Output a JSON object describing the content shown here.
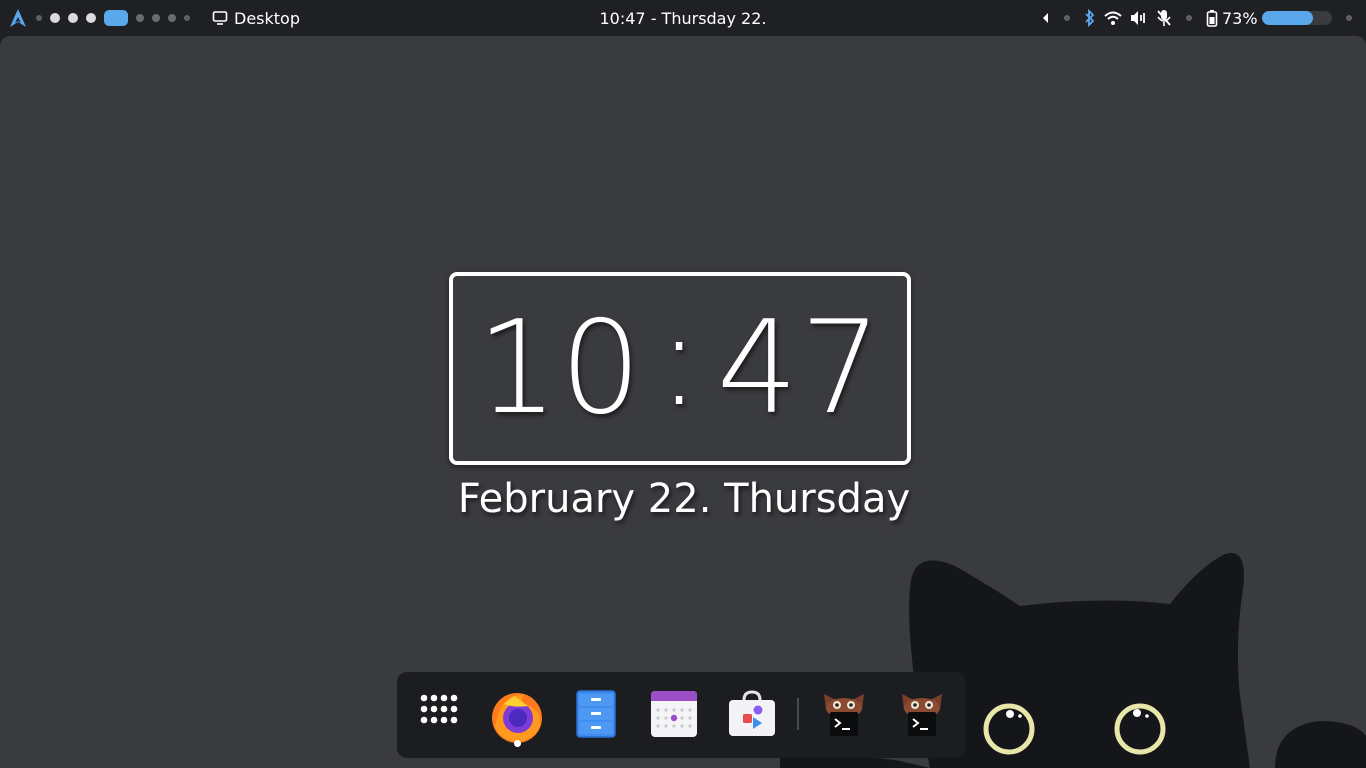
{
  "topbar": {
    "activities_icon": "arch-logo-icon",
    "window_title": "Desktop",
    "clock": "10:47 - Thursday 22.",
    "battery_percent": "73%",
    "battery_level": 0.73,
    "workspaces_total": 8,
    "workspace_active_index": 3
  },
  "clock_widget": {
    "hours": "10",
    "minutes": "47",
    "separator": ":",
    "date": "February 22. Thursday"
  },
  "dock": {
    "items": [
      {
        "name": "app-grid",
        "icon": "app-grid-icon"
      },
      {
        "name": "firefox",
        "icon": "firefox-icon",
        "running": true
      },
      {
        "name": "files",
        "icon": "file-cabinet-icon"
      },
      {
        "name": "calendar",
        "icon": "calendar-icon"
      },
      {
        "name": "software",
        "icon": "software-store-icon"
      },
      {
        "name": "terminal",
        "icon": "terminal-cat-icon"
      },
      {
        "name": "terminal-2",
        "icon": "terminal-cat-icon"
      }
    ]
  },
  "colors": {
    "accent": "#5aa7ec",
    "panel": "#1f2023",
    "desktop": "#3a3b3f",
    "power": "#e06c75"
  }
}
